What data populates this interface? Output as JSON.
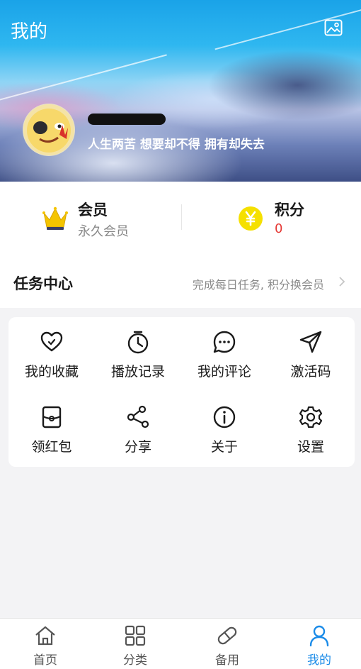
{
  "header": {
    "title": "我的",
    "signature": "人生两苦 想要却不得 拥有却失去",
    "wallpaper_icon": "image-icon"
  },
  "stats": {
    "member": {
      "label": "会员",
      "value": "永久会员",
      "icon": "crown-icon"
    },
    "points": {
      "label": "积分",
      "value": "0",
      "icon": "yen-coin-icon"
    }
  },
  "task_center": {
    "title": "任务中心",
    "description": "完成每日任务, 积分换会员"
  },
  "menu": {
    "items": [
      {
        "label": "我的收藏",
        "icon": "heart-icon"
      },
      {
        "label": "播放记录",
        "icon": "clock-icon"
      },
      {
        "label": "我的评论",
        "icon": "comment-icon"
      },
      {
        "label": "激活码",
        "icon": "send-icon"
      },
      {
        "label": "领红包",
        "icon": "red-envelope-icon"
      },
      {
        "label": "分享",
        "icon": "share-icon"
      },
      {
        "label": "关于",
        "icon": "info-icon"
      },
      {
        "label": "设置",
        "icon": "gear-icon"
      }
    ]
  },
  "tabbar": {
    "items": [
      {
        "label": "首页",
        "icon": "home-icon",
        "active": false
      },
      {
        "label": "分类",
        "icon": "grid-icon",
        "active": false
      },
      {
        "label": "备用",
        "icon": "pill-icon",
        "active": false
      },
      {
        "label": "我的",
        "icon": "user-icon",
        "active": true
      }
    ]
  },
  "colors": {
    "accent": "#1a8be8",
    "points_value": "#e53935",
    "coin": "#f5e000",
    "crown": "#f4c400"
  }
}
